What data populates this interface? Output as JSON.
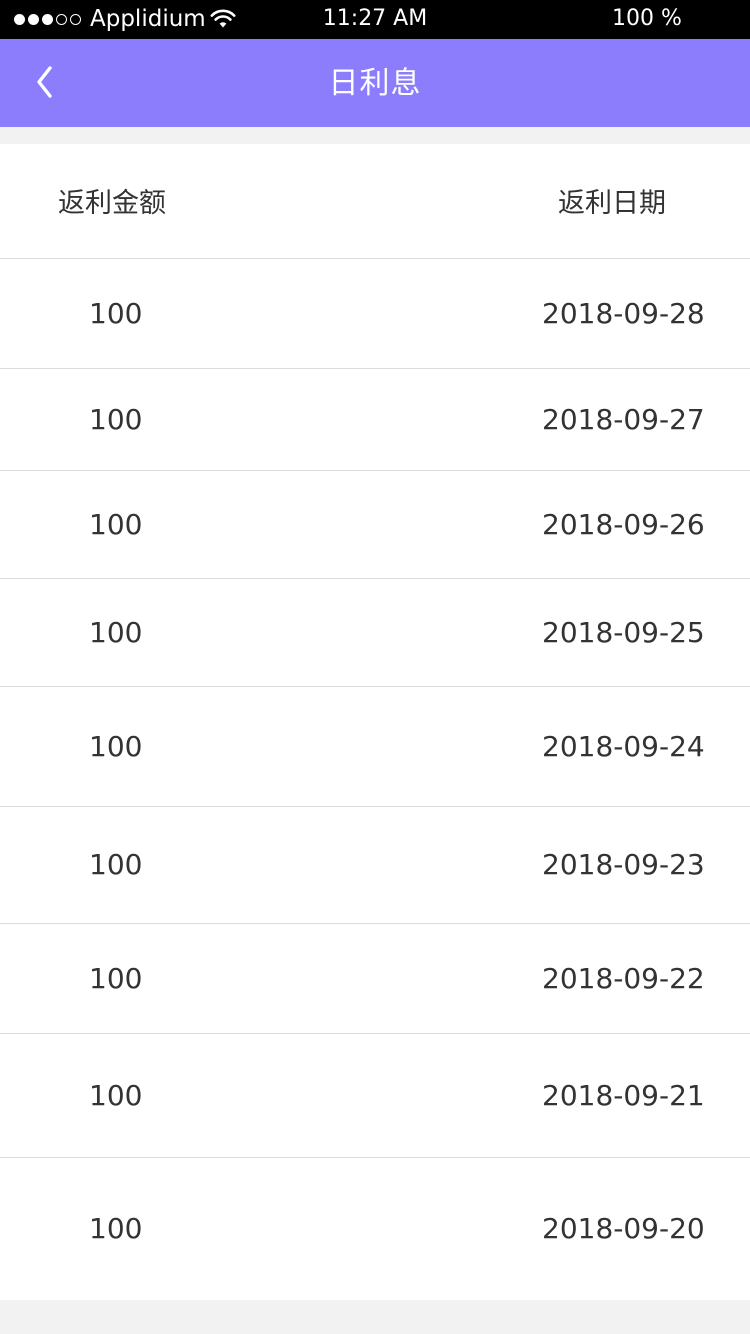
{
  "status_bar": {
    "carrier": "Applidium",
    "time": "11:27 AM",
    "battery": "100 %",
    "signal_dots": [
      "full",
      "full",
      "full",
      "empty",
      "empty"
    ]
  },
  "nav": {
    "title": "日利息",
    "back_icon": "chevron-left-icon",
    "background": "#8b7dfb"
  },
  "table": {
    "headers": {
      "amount": "返利金额",
      "date": "返利日期"
    },
    "rows": [
      {
        "amount": "100",
        "date": "2018-09-28"
      },
      {
        "amount": "100",
        "date": "2018-09-27"
      },
      {
        "amount": "100",
        "date": "2018-09-26"
      },
      {
        "amount": "100",
        "date": "2018-09-25"
      },
      {
        "amount": "100",
        "date": "2018-09-24"
      },
      {
        "amount": "100",
        "date": "2018-09-23"
      },
      {
        "amount": "100",
        "date": "2018-09-22"
      },
      {
        "amount": "100",
        "date": "2018-09-21"
      },
      {
        "amount": "100",
        "date": "2018-09-20"
      }
    ]
  }
}
